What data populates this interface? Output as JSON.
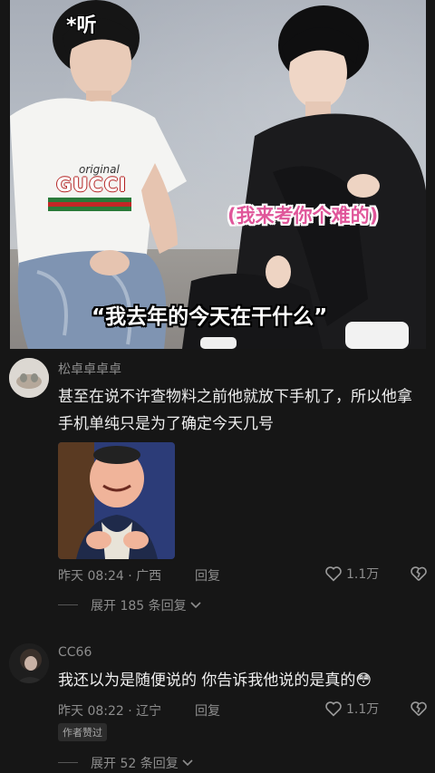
{
  "video": {
    "subtitle_top": "*听",
    "subtitle_pink": "(我来考你个难的)",
    "subtitle_bottom": "“我去年的今天在干什么”",
    "tshirt_text": "original",
    "tshirt_logo": "GUCCI"
  },
  "comments": [
    {
      "username": "松卓卓卓卓",
      "text": "甚至在说不许查物料之前他就放下手机了，所以他拿手机单纯只是为了确定今天几号",
      "has_image": true,
      "meta": "昨天 08:24 · 广西",
      "reply_label": "回复",
      "likes": "1.1万",
      "expand_label": "展开 185 条回复"
    },
    {
      "username": "CC66",
      "text": "我还以为是随便说的  你告诉我他说的是真的",
      "emoji": "😳",
      "meta": "昨天 08:22 · 辽宁",
      "reply_label": "回复",
      "likes": "1.1万",
      "badge": "作者赞过",
      "expand_label": "展开 52 条回复"
    }
  ],
  "icons": {
    "heart": "heart-icon",
    "dislike": "broken-heart-icon",
    "chevron": "chevron-down-icon"
  }
}
